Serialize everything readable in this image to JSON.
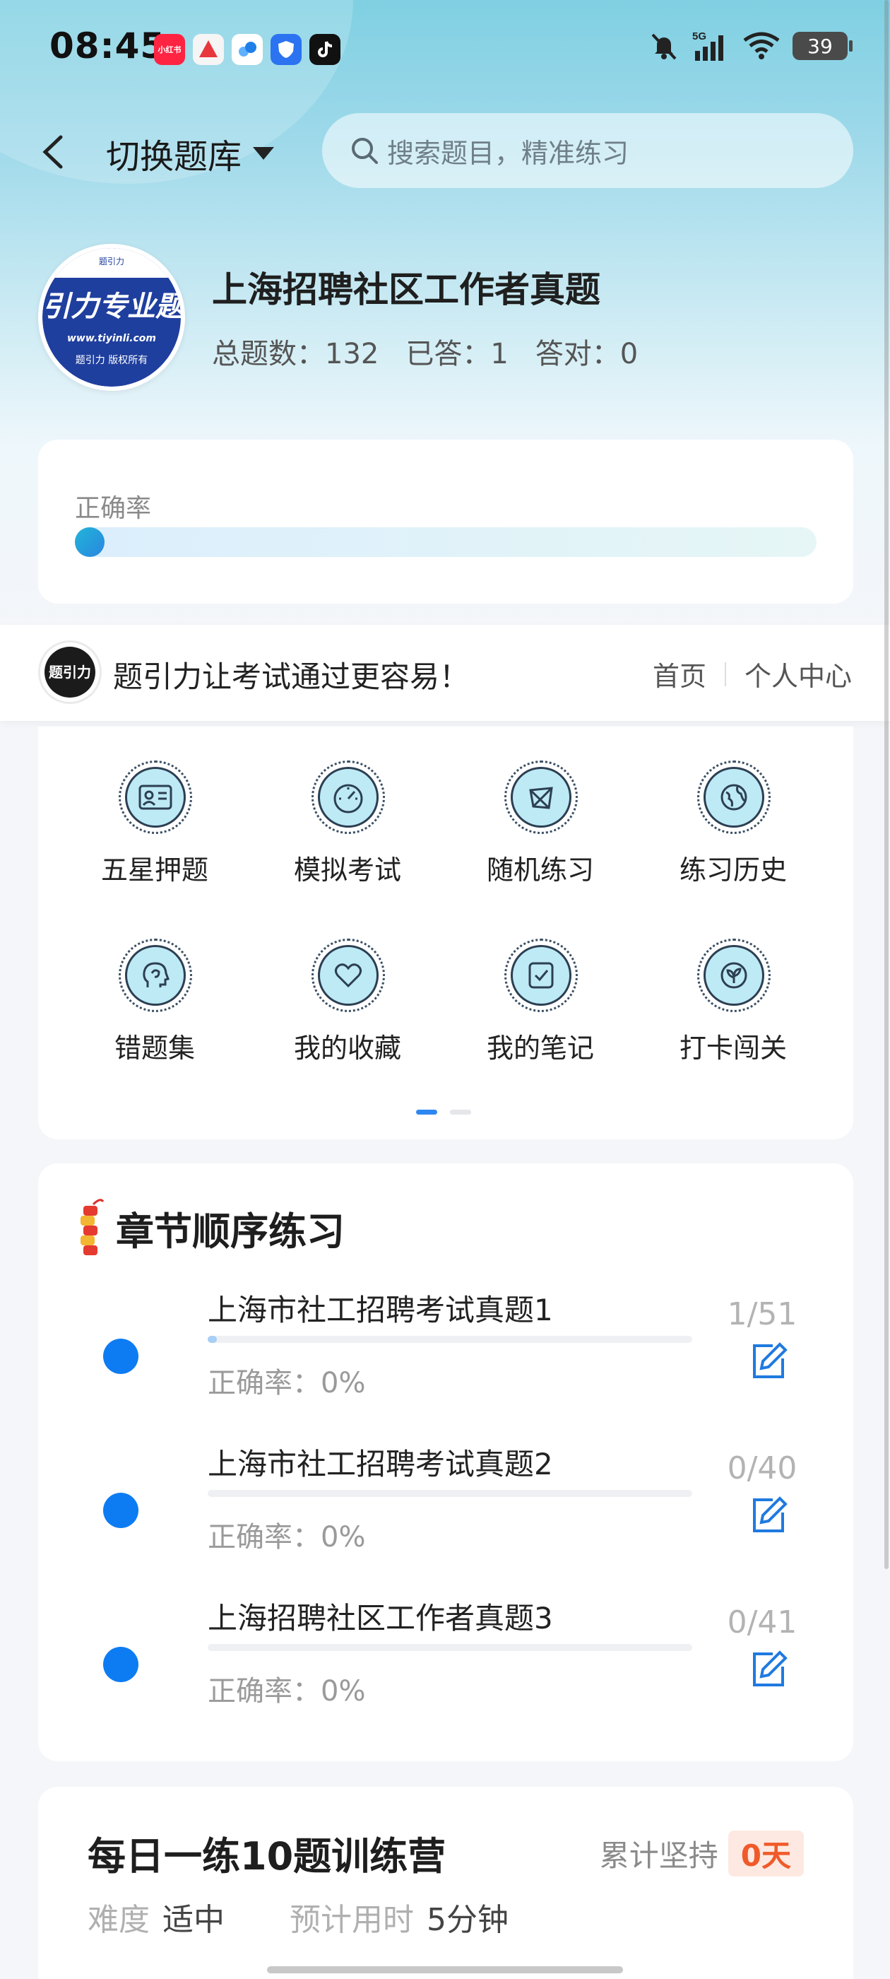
{
  "status_bar": {
    "time": "08:45",
    "network": "5G",
    "battery": "39",
    "app_icons": [
      {
        "name": "xiaohongshu-icon",
        "label": "小红书",
        "color": "#ff2442"
      },
      {
        "name": "toutiao-icon",
        "label": "",
        "color": "#f2f2f2"
      },
      {
        "name": "cloud-app-icon",
        "label": "",
        "color": "#ffffff"
      },
      {
        "name": "shield-app-icon",
        "label": "",
        "color": "#2b73f0"
      },
      {
        "name": "tiktok-icon",
        "label": "",
        "color": "#111111"
      }
    ]
  },
  "nav": {
    "bank_switch_label": "切换题库",
    "search_placeholder": "搜索题目，精准练习"
  },
  "bank": {
    "logo_text": "引力专业题",
    "logo_url": "www.tiyinli.com",
    "logo_footer": "题引力 版权所有",
    "logo_top": "题引力",
    "title": "上海招聘社区工作者真题",
    "stats": {
      "total": "总题数：132",
      "answered": "已答：1",
      "correct": "答对：0"
    }
  },
  "accuracy": {
    "label": "正确率",
    "value": 0
  },
  "brand": {
    "logo_text": "题引力",
    "slogan": "题引力让考试通过更容易！",
    "links": {
      "home": "首页",
      "personal": "个人中心"
    }
  },
  "functions": [
    {
      "label": "五星押题",
      "icon": "id-card-icon"
    },
    {
      "label": "模拟考试",
      "icon": "speedometer-icon"
    },
    {
      "label": "随机练习",
      "icon": "shuffle-icon"
    },
    {
      "label": "练习历史",
      "icon": "globe-icon"
    },
    {
      "label": "错题集",
      "icon": "head-icon"
    },
    {
      "label": "我的收藏",
      "icon": "heart-icon"
    },
    {
      "label": "我的笔记",
      "icon": "checklist-icon"
    },
    {
      "label": "打卡闯关",
      "icon": "leaf-icon"
    }
  ],
  "chapters": {
    "title": "章节顺序练习",
    "items": [
      {
        "name": "上海市社工招聘考试真题1",
        "accuracy": "正确率：0%",
        "count": "1/51",
        "progress": 0.0196
      },
      {
        "name": "上海市社工招聘考试真题2",
        "accuracy": "正确率：0%",
        "count": "0/40",
        "progress": 0
      },
      {
        "name": "上海招聘社区工作者真题3",
        "accuracy": "正确率：0%",
        "count": "0/41",
        "progress": 0
      }
    ]
  },
  "daily": {
    "title": "每日一练10题训练营",
    "streak_label": "累计坚持",
    "streak_value": "0天",
    "difficulty_key": "难度",
    "difficulty_value": "适中",
    "time_key": "预计用时",
    "time_value": "5分钟"
  },
  "colors": {
    "accent": "#0d7cf2",
    "streak": "#f05a2a",
    "icon_fill": "#bdeaf5"
  }
}
